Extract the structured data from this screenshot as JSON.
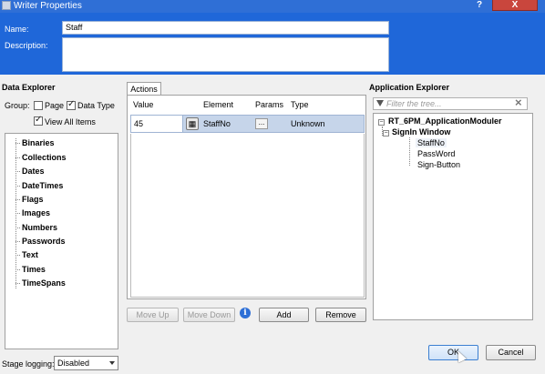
{
  "window": {
    "title": "Writer Properties",
    "help_label": "?",
    "close_label": "X"
  },
  "header": {
    "name_label": "Name:",
    "name_value": "Staff",
    "description_label": "Description:",
    "description_value": ""
  },
  "data_explorer": {
    "title": "Data Explorer",
    "group_label": "Group:",
    "page_label": "Page",
    "page_checked": false,
    "data_type_label": "Data Type",
    "data_type_checked": true,
    "view_all_label": "View All Items",
    "view_all_checked": true,
    "items": [
      "Binaries",
      "Collections",
      "Dates",
      "DateTimes",
      "Flags",
      "Images",
      "Numbers",
      "Passwords",
      "Text",
      "Times",
      "TimeSpans"
    ]
  },
  "actions": {
    "tab_label": "Actions",
    "columns": {
      "value": "Value",
      "element": "Element",
      "params": "Params",
      "type": "Type"
    },
    "row": {
      "value": "45",
      "element": "StaffNo",
      "params_button": "...",
      "type": "Unknown"
    },
    "buttons": {
      "move_up": "Move Up",
      "move_down": "Move Down",
      "add": "Add",
      "remove": "Remove"
    },
    "info_icon": "i"
  },
  "application_explorer": {
    "title": "Application Explorer",
    "filter_placeholder": "Filter the tree...",
    "clear_icon": "×",
    "root": "RT_6PM_ApplicationModuler",
    "window": "SignIn Window",
    "elements": [
      "StaffNo",
      "PassWord",
      "Sign-Button"
    ]
  },
  "footer": {
    "stage_logging_label": "Stage logging:",
    "stage_logging_value": "Disabled",
    "ok_label": "OK",
    "cancel_label": "Cancel"
  },
  "colors": {
    "title_bar": "#2f6fd6",
    "header_panel": "#1f67d9",
    "selected_row": "#c6d5ea",
    "close_button": "#c9463d"
  }
}
